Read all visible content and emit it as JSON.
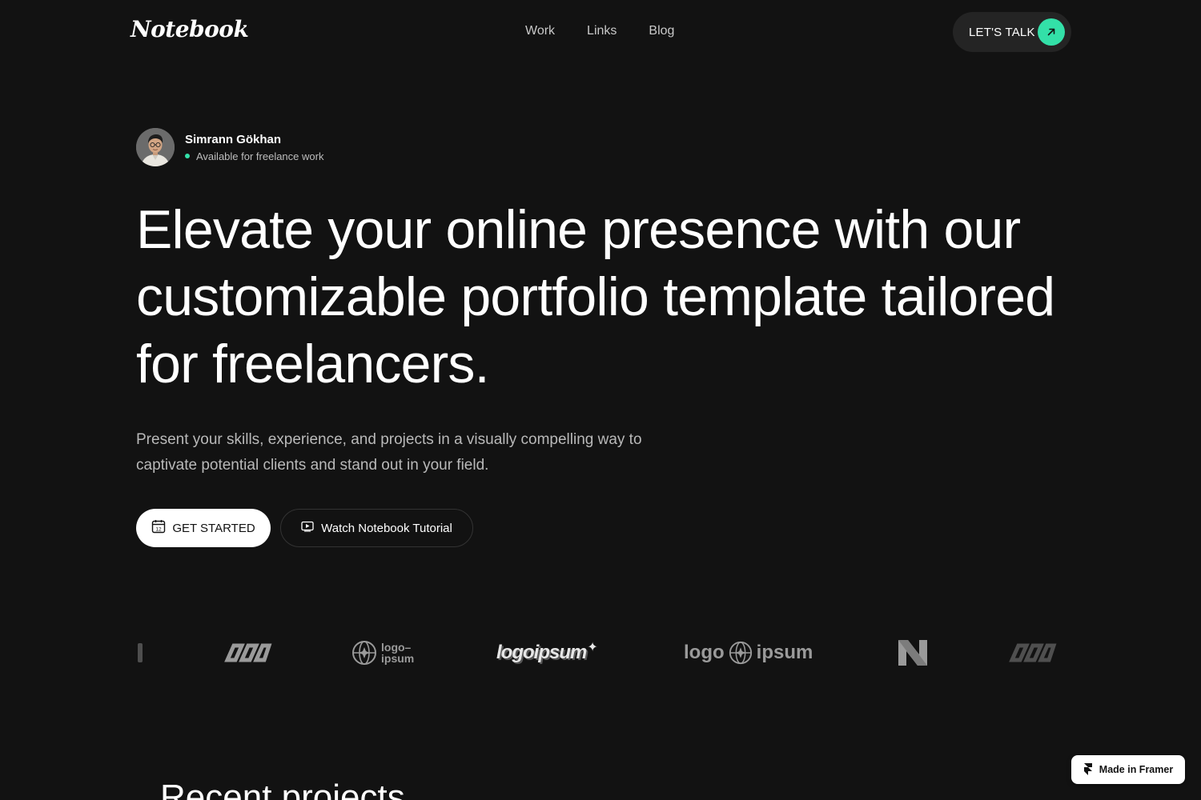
{
  "header": {
    "logo": "Notebook",
    "nav": [
      "Work",
      "Links",
      "Blog"
    ],
    "cta_label": "LET'S TALK",
    "cta_icon": "arrow-up-right-icon",
    "accent": "#33e0a8"
  },
  "profile": {
    "name": "Simrann Gökhan",
    "status": "Available for freelance work"
  },
  "hero": {
    "headline": "Elevate your online presence with our customizable portfolio template tailored for freelancers.",
    "subtext": "Present your skills, experience, and projects in a visually compelling way to captivate potential clients and stand out in your field.",
    "primary_button": "GET STARTED",
    "primary_icon": "calendar-icon",
    "calendar_day": "12",
    "secondary_button": "Watch Notebook Tutorial",
    "secondary_icon": "video-icon"
  },
  "logos": {
    "items": [
      "logo-ipsum-loops",
      "logo-ipsum-globe-stacked",
      "logoipsum",
      "logo ipsum",
      "N",
      "logo-ipsum-loops"
    ],
    "wordmark_stacked_top": "logo–",
    "wordmark_stacked_bottom": "ipsum",
    "wordmark_bold": "logoipsum",
    "wordmark_split_left": "logo",
    "wordmark_split_right": "ipsum"
  },
  "recent": {
    "title": "Recent projects"
  },
  "badge": {
    "label": "Made in Framer"
  }
}
